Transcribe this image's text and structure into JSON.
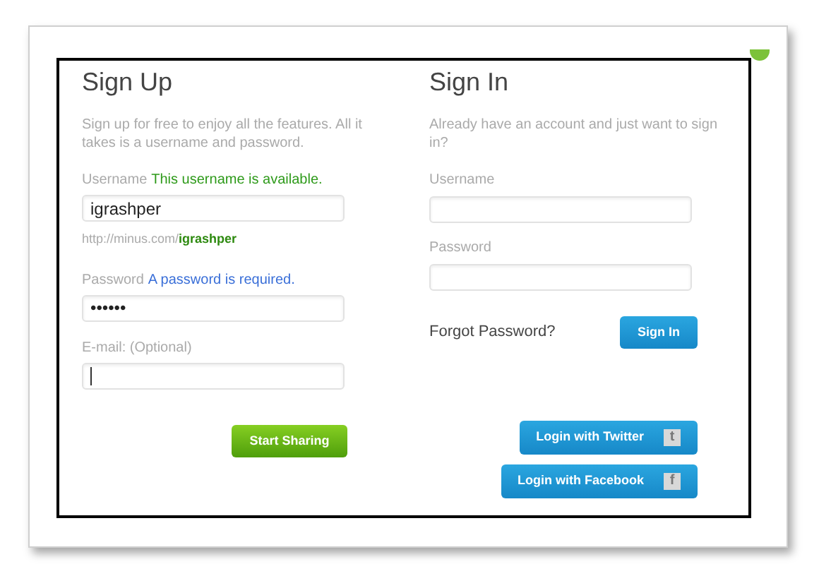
{
  "signup": {
    "title": "Sign Up",
    "intro": "Sign up for free to enjoy all the features. All it takes is a username and password.",
    "username": {
      "label": "Username",
      "status": "This username is available.",
      "kind": "ok",
      "value": "igrashper"
    },
    "url": {
      "prefix": "http://minus.com/",
      "name": "igrashper"
    },
    "password": {
      "label": "Password",
      "status": "A password is required.",
      "kind": "info",
      "value": "••••••"
    },
    "email": {
      "label": "E-mail: (Optional)",
      "focused": true
    },
    "button": "Start Sharing"
  },
  "signin": {
    "title": "Sign In",
    "intro": "Already have an account and just want to sign in?",
    "fields": [
      {
        "label": "Username"
      },
      {
        "label": "Password"
      }
    ],
    "forgot": "Forgot Password?",
    "button": "Sign In",
    "social": [
      {
        "label": "Login with Twitter",
        "glyph": "t"
      },
      {
        "label": "Login with Facebook",
        "glyph": "f"
      }
    ]
  }
}
